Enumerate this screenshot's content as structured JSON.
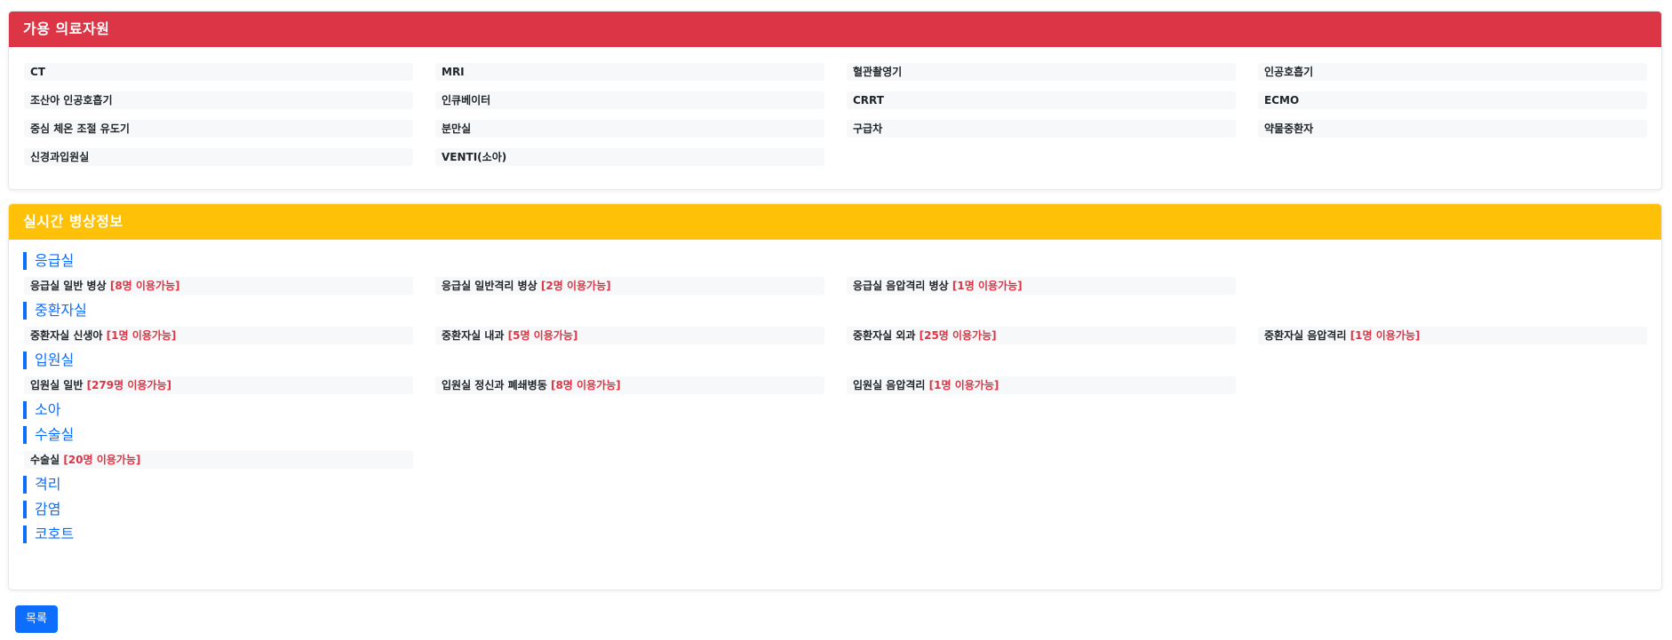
{
  "equipment": {
    "title": "가용 의료자원",
    "items": [
      "CT",
      "MRI",
      "혈관촬영기",
      "인공호흡기",
      "조산아 인공호흡기",
      "인큐베이터",
      "CRRT",
      "ECMO",
      "중심 체온 조절 유도기",
      "분만실",
      "구급차",
      "약물중환자",
      "신경과입원실",
      "VENTI(소아)"
    ]
  },
  "beds": {
    "title": "실시간 병상정보",
    "sections": [
      {
        "title": "응급실",
        "items": [
          {
            "label": "응급실 일반 병상",
            "avail": "[8명 이용가능]"
          },
          {
            "label": "응급실 일반격리 병상",
            "avail": "[2명 이용가능]"
          },
          {
            "label": "응급실 음압격리 병상",
            "avail": "[1명 이용가능]"
          }
        ]
      },
      {
        "title": "중환자실",
        "items": [
          {
            "label": "중환자실 신생아",
            "avail": "[1명 이용가능]"
          },
          {
            "label": "중환자실 내과",
            "avail": "[5명 이용가능]"
          },
          {
            "label": "중환자실 외과",
            "avail": "[25명 이용가능]"
          },
          {
            "label": "중환자실 음압격리",
            "avail": "[1명 이용가능]"
          }
        ]
      },
      {
        "title": "입원실",
        "items": [
          {
            "label": "입원실 일반",
            "avail": "[279명 이용가능]"
          },
          {
            "label": "입원실 정신과 폐쇄병동",
            "avail": "[8명 이용가능]"
          },
          {
            "label": "입원실 음압격리",
            "avail": "[1명 이용가능]"
          }
        ]
      },
      {
        "title": "소아",
        "items": []
      },
      {
        "title": "수술실",
        "items": [
          {
            "label": "수술실",
            "avail": "[20명 이용가능]"
          }
        ]
      },
      {
        "title": "격리",
        "items": []
      },
      {
        "title": "감염",
        "items": []
      },
      {
        "title": "코호트",
        "items": []
      }
    ]
  },
  "actions": {
    "list_label": "목록"
  },
  "colors": {
    "equipment_header": "#dc3545",
    "beds_header": "#ffc107",
    "accent": "#0d6efd",
    "available": "#dc3545"
  }
}
